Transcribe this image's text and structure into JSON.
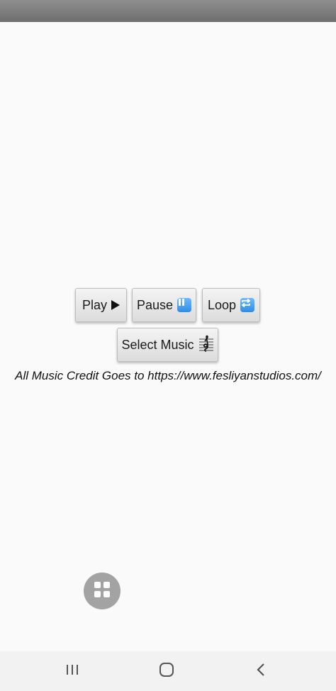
{
  "controls": {
    "play_label": "Play",
    "pause_label": "Pause",
    "loop_label": "Loop",
    "select_music_label": "Select Music"
  },
  "icons": {
    "play": "play-triangle-icon",
    "pause": "pause-emoji-icon",
    "loop": "repeat-emoji-icon",
    "music": "musical-score-icon",
    "fab": "grid-icon",
    "recents": "recents-icon",
    "home": "home-icon",
    "back": "back-icon"
  },
  "credit": {
    "text": "All Music Credit Goes to https://www.fesliyanstudios.com/"
  },
  "colors": {
    "background": "#fafafa",
    "status_bar": "#7f7f7f",
    "button_face": "#e8e8e8",
    "emoji_blue": "#3d97ee",
    "fab": "#a3a3a3",
    "nav_bar": "#f2f2f2"
  }
}
